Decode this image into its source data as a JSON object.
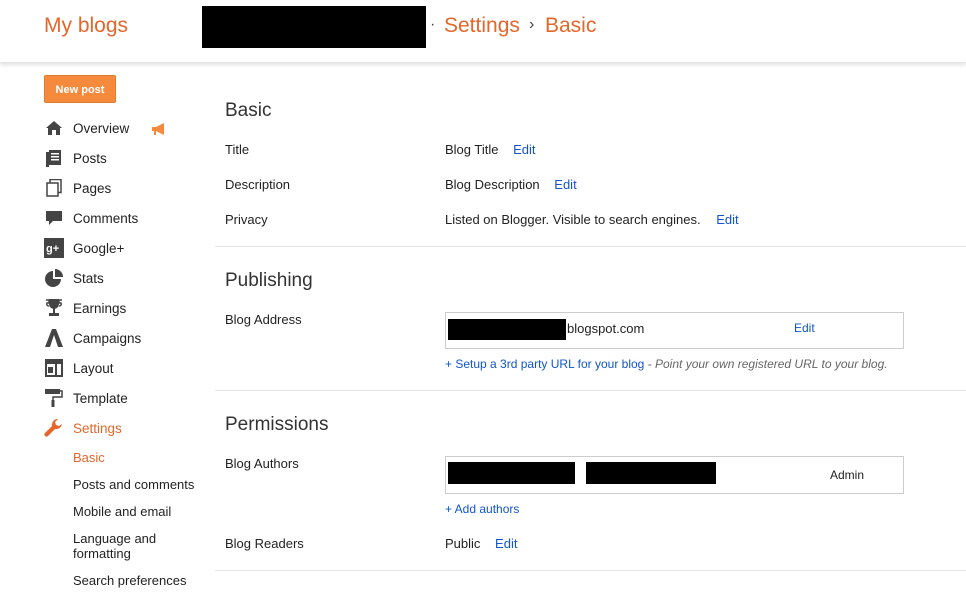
{
  "header": {
    "my_blogs": "My blogs",
    "dot": "·",
    "crumb_settings": "Settings",
    "crumb_sep": "›",
    "crumb_basic": "Basic"
  },
  "sidebar": {
    "new_post": "New post",
    "items": [
      {
        "label": "Overview",
        "icon": "home-icon"
      },
      {
        "label": "Posts",
        "icon": "posts-icon"
      },
      {
        "label": "Pages",
        "icon": "pages-icon"
      },
      {
        "label": "Comments",
        "icon": "comment-icon"
      },
      {
        "label": "Google+",
        "icon": "google-plus-icon"
      },
      {
        "label": "Stats",
        "icon": "pie-chart-icon"
      },
      {
        "label": "Earnings",
        "icon": "trophy-icon"
      },
      {
        "label": "Campaigns",
        "icon": "campaigns-icon"
      },
      {
        "label": "Layout",
        "icon": "layout-icon"
      },
      {
        "label": "Template",
        "icon": "paint-roller-icon"
      },
      {
        "label": "Settings",
        "icon": "wrench-icon"
      }
    ],
    "sub_items": [
      "Basic",
      "Posts and comments",
      "Mobile and email",
      "Language and formatting",
      "Search preferences"
    ],
    "active_color": "#e5662a"
  },
  "basic": {
    "heading": "Basic",
    "title_label": "Title",
    "title_value": "Blog Title",
    "description_label": "Description",
    "description_value": "Blog Description",
    "privacy_label": "Privacy",
    "privacy_value": "Listed on Blogger. Visible to search engines.",
    "edit": "Edit"
  },
  "publishing": {
    "heading": "Publishing",
    "address_label": "Blog Address",
    "address_suffix": "blogspot.com",
    "edit": "Edit",
    "setup_link": "+ Setup a 3rd party URL for your blog",
    "setup_hint": " - Point your own registered URL to your blog."
  },
  "permissions": {
    "heading": "Permissions",
    "authors_label": "Blog Authors",
    "author_role": "Admin",
    "add_authors": "+ Add authors",
    "readers_label": "Blog Readers",
    "readers_value": "Public",
    "edit": "Edit"
  }
}
